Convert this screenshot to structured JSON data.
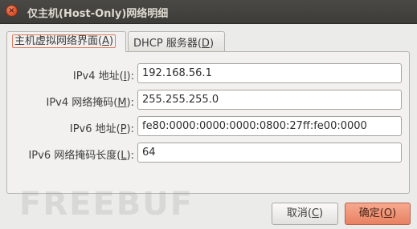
{
  "window": {
    "title": "仅主机(Host-Only)网络明细",
    "close_glyph": "×"
  },
  "tabs": [
    {
      "pre": "主机虚拟网络界面(",
      "key": "A",
      "post": ")"
    },
    {
      "pre": "DHCP 服务器(",
      "key": "D",
      "post": ")"
    }
  ],
  "fields": [
    {
      "label_pre": "IPv4 地址(",
      "key": "I",
      "label_post": "):",
      "value": "192.168.56.1"
    },
    {
      "label_pre": "IPv4 网络掩码(",
      "key": "M",
      "label_post": "):",
      "value": "255.255.255.0"
    },
    {
      "label_pre": "IPv6 地址(",
      "key": "P",
      "label_post": "):",
      "value": "fe80:0000:0000:0000:0800:27ff:fe00:0000"
    },
    {
      "label_pre": "IPv6 网络掩码长度(",
      "key": "L",
      "label_post": "):",
      "value": "64"
    }
  ],
  "buttons": {
    "cancel": {
      "pre": "取消(",
      "key": "C",
      "post": ")"
    },
    "ok": {
      "pre": "确定(",
      "key": "O",
      "post": ")"
    }
  },
  "watermark": "FREEBUF",
  "colors": {
    "accent": "#e07a5f",
    "titlebar": "#3d3c38",
    "window_bg": "#ebebe9"
  }
}
